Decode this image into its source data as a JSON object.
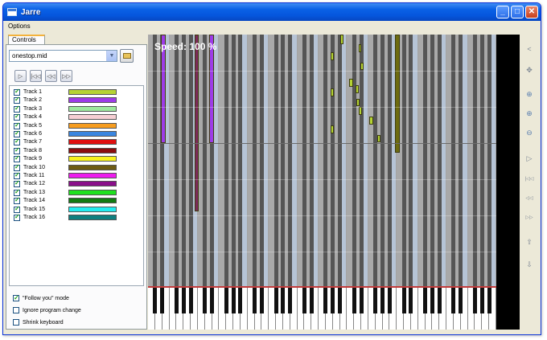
{
  "window": {
    "title": "Jarre"
  },
  "titlebar_buttons": [
    {
      "name": "minimize-button",
      "glyph": "_"
    },
    {
      "name": "maximize-button",
      "glyph": "□"
    },
    {
      "name": "close-button",
      "glyph": "✕"
    }
  ],
  "menu": {
    "options": "Options"
  },
  "tabs": {
    "controls": "Controls"
  },
  "file": {
    "selected": "onestop.mid"
  },
  "transport": [
    {
      "name": "play-button",
      "icon": "play-icon",
      "glyph": "▷"
    },
    {
      "name": "restart-button",
      "icon": "restart-icon",
      "glyph": "|◁◁"
    },
    {
      "name": "rewind-button",
      "icon": "rewind-icon",
      "glyph": "◁◁"
    },
    {
      "name": "forward-button",
      "icon": "forward-icon",
      "glyph": "▷▷"
    }
  ],
  "tracks": [
    {
      "label": "Track 1",
      "color": "#b5d334",
      "checked": true
    },
    {
      "label": "Track 2",
      "color": "#9d3be8",
      "checked": true
    },
    {
      "label": "Track 3",
      "color": "#9de89d",
      "checked": true
    },
    {
      "label": "Track 4",
      "color": "#f6cfd3",
      "checked": true
    },
    {
      "label": "Track 5",
      "color": "#f79d1f",
      "checked": true
    },
    {
      "label": "Track 6",
      "color": "#3a86e0",
      "checked": true
    },
    {
      "label": "Track 7",
      "color": "#e01010",
      "checked": true
    },
    {
      "label": "Track 8",
      "color": "#8a0e0e",
      "checked": true
    },
    {
      "label": "Track 9",
      "color": "#f7f31d",
      "checked": true
    },
    {
      "label": "Track 10",
      "color": "#6d5b14",
      "checked": true
    },
    {
      "label": "Track 11",
      "color": "#ee1cee",
      "checked": true
    },
    {
      "label": "Track 12",
      "color": "#8a0f8a",
      "checked": true
    },
    {
      "label": "Track 13",
      "color": "#1ee01e",
      "checked": true
    },
    {
      "label": "Track 14",
      "color": "#127a12",
      "checked": true
    },
    {
      "label": "Track 15",
      "color": "#22ecef",
      "checked": true
    },
    {
      "label": "Track 16",
      "color": "#0f7f7f",
      "checked": true
    }
  ],
  "options": {
    "follow_you": {
      "label": "\"Follow you\" mode",
      "checked": true
    },
    "ignore_program_change": {
      "label": "Ignore program change",
      "checked": false
    },
    "shrink_keyboard": {
      "label": "Shrink keyboard",
      "checked": false
    }
  },
  "roll": {
    "speed_label": "Speed: 100 %"
  },
  "toolbar": [
    {
      "name": "collapse-button",
      "icon": "chevron-left-icon",
      "glyph": "<"
    },
    {
      "name": "move-button",
      "icon": "move-icon",
      "glyph": "✥"
    },
    {
      "name": "zoom-button",
      "icon": "zoom-icon",
      "glyph": "⊕"
    },
    {
      "name": "zoom-in-button",
      "icon": "zoom-in-icon",
      "glyph": "⊕"
    },
    {
      "name": "zoom-out-button",
      "icon": "zoom-out-icon",
      "glyph": "⊖"
    },
    {
      "name": "play-tool-button",
      "icon": "play-icon",
      "glyph": "▷"
    },
    {
      "name": "restart-tool-button",
      "icon": "restart-icon",
      "glyph": "|◁◁"
    },
    {
      "name": "rewind-tool-button",
      "icon": "rewind-icon",
      "glyph": "◁◁"
    },
    {
      "name": "forward-tool-button",
      "icon": "forward-icon",
      "glyph": "▷▷"
    },
    {
      "name": "up-button",
      "icon": "arrow-up-icon",
      "glyph": "⇧"
    },
    {
      "name": "down-button",
      "icon": "arrow-down-icon",
      "glyph": "⇩"
    }
  ]
}
